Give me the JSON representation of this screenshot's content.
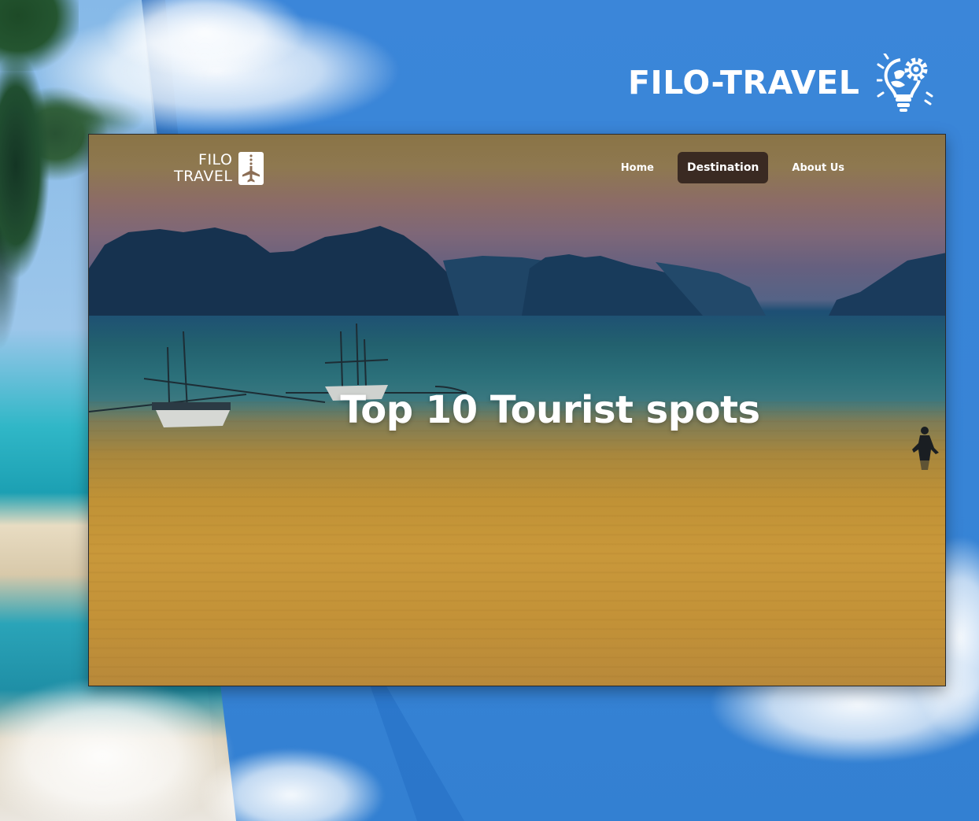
{
  "brand": {
    "name": "FILO-TRAVEL",
    "icon": "lightbulb-gear-icon"
  },
  "site": {
    "logo": {
      "line1": "FILO",
      "line2": "TRAVEL",
      "icon": "airplane-icon"
    },
    "nav": [
      {
        "label": "Home",
        "active": false
      },
      {
        "label": "Destination",
        "active": true
      },
      {
        "label": "About Us",
        "active": false
      }
    ],
    "hero_title": "Top 10 Tourist spots"
  },
  "colors": {
    "background": "#3a86d8",
    "active_nav": "#3a2a22",
    "text": "#ffffff"
  }
}
